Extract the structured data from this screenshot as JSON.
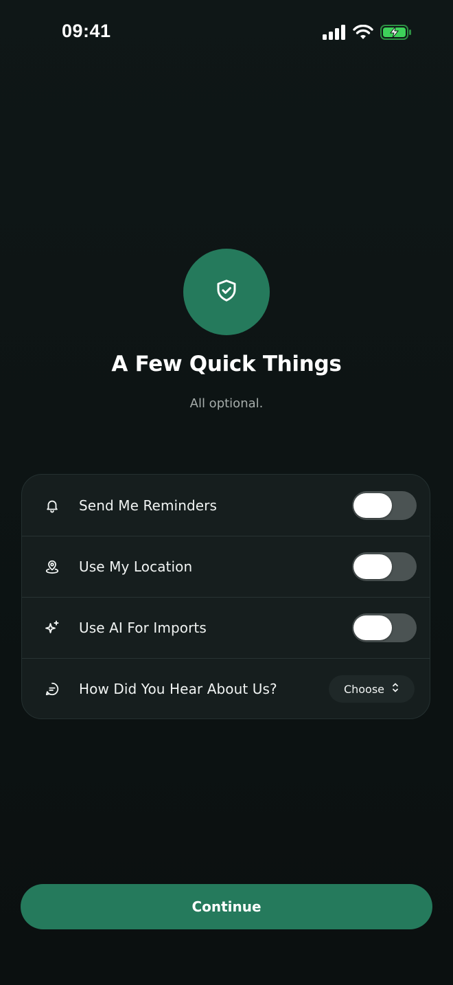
{
  "status_bar": {
    "time": "09:41",
    "signal_icon": "cellular-signal-icon",
    "wifi_icon": "wifi-icon",
    "battery_icon": "battery-charging-icon"
  },
  "hero": {
    "icon": "shield-check-icon",
    "title": "A Few Quick Things",
    "subtitle": "All optional."
  },
  "settings": {
    "rows": [
      {
        "icon": "bell-icon",
        "label": "Send Me Reminders",
        "enabled": false
      },
      {
        "icon": "location-pin-icon",
        "label": "Use My Location",
        "enabled": false
      },
      {
        "icon": "sparkles-icon",
        "label": "Use AI For Imports",
        "enabled": false
      },
      {
        "icon": "chat-bubble-icon",
        "label": "How Did You Hear About Us?",
        "select_value": "Choose"
      }
    ]
  },
  "footer": {
    "continue_label": "Continue"
  },
  "colors": {
    "background": "#0d1414",
    "accent": "#257a5c",
    "card": "#161e1e",
    "battery": "#3ed15a"
  }
}
